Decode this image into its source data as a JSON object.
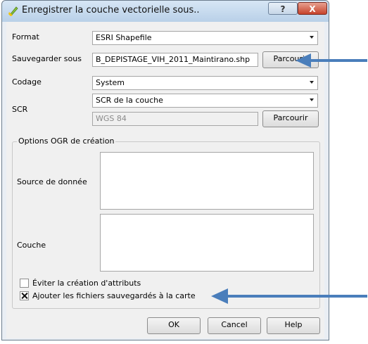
{
  "window": {
    "title": "Enregistrer la couche vectorielle sous..",
    "help_glyph": "?",
    "close_glyph": "X"
  },
  "form": {
    "format_label": "Format",
    "format_value": "ESRI Shapefile",
    "save_as_label": "Sauvegarder sous",
    "save_as_value": "B_DEPISTAGE_VIH_2011_Maintirano.shp",
    "browse_label": "Parcourir",
    "encoding_label": "Codage",
    "encoding_value": "System",
    "crs_label": "SCR",
    "crs_mode_value": "SCR de la couche",
    "crs_value": "WGS 84",
    "crs_browse_label": "Parcourir"
  },
  "ogr_options": {
    "group_title": "Options OGR de création",
    "datasource_label": "Source de donnée",
    "layer_label": "Couche",
    "skip_attributes_label": "Éviter la création d'attributs",
    "skip_attributes_checked": false,
    "add_to_map_label": "Ajouter les fichiers sauvegardés à la carte",
    "add_to_map_checked": true
  },
  "buttons": {
    "ok": "OK",
    "cancel": "Cancel",
    "help": "Help"
  },
  "colors": {
    "annotation_arrow": "#4a7ebb"
  }
}
